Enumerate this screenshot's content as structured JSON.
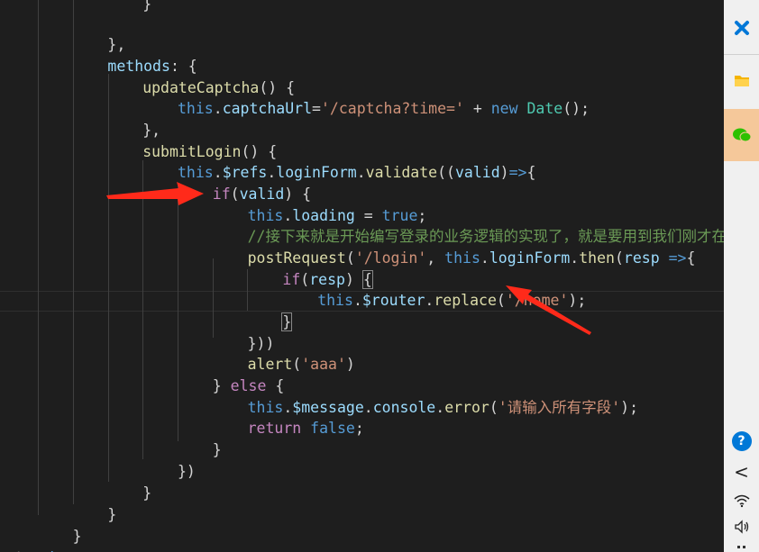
{
  "editor": {
    "lines": [
      [
        {
          "t": "}",
          "c": "pun"
        }
      ],
      [
        {
          "t": "},",
          "c": "pun"
        }
      ],
      [
        {
          "t": "methods",
          "c": "var"
        },
        {
          "t": ": {",
          "c": "pun"
        }
      ],
      [
        {
          "t": "updateCaptcha",
          "c": "fn"
        },
        {
          "t": "() {",
          "c": "pun"
        }
      ],
      [
        {
          "t": "this",
          "c": "kw"
        },
        {
          "t": ".",
          "c": "pun"
        },
        {
          "t": "captchaUrl",
          "c": "var"
        },
        {
          "t": "=",
          "c": "pun"
        },
        {
          "t": "'/captcha?time='",
          "c": "str"
        },
        {
          "t": " + ",
          "c": "pun"
        },
        {
          "t": "new",
          "c": "kw"
        },
        {
          "t": " ",
          "c": "pun"
        },
        {
          "t": "Date",
          "c": "cls"
        },
        {
          "t": "();",
          "c": "pun"
        }
      ],
      [
        {
          "t": "},",
          "c": "pun"
        }
      ],
      [
        {
          "t": "submitLogin",
          "c": "fn"
        },
        {
          "t": "() {",
          "c": "pun"
        }
      ],
      [
        {
          "t": "this",
          "c": "kw"
        },
        {
          "t": ".",
          "c": "pun"
        },
        {
          "t": "$refs",
          "c": "var"
        },
        {
          "t": ".",
          "c": "pun"
        },
        {
          "t": "loginForm",
          "c": "var"
        },
        {
          "t": ".",
          "c": "pun"
        },
        {
          "t": "validate",
          "c": "fn"
        },
        {
          "t": "((",
          "c": "pun"
        },
        {
          "t": "valid",
          "c": "var"
        },
        {
          "t": ")",
          "c": "pun"
        },
        {
          "t": "=>",
          "c": "kw"
        },
        {
          "t": "{",
          "c": "pun"
        }
      ],
      [
        {
          "t": "if",
          "c": "ctl"
        },
        {
          "t": "(",
          "c": "pun"
        },
        {
          "t": "valid",
          "c": "var"
        },
        {
          "t": ") {",
          "c": "pun"
        }
      ],
      [
        {
          "t": "this",
          "c": "kw"
        },
        {
          "t": ".",
          "c": "pun"
        },
        {
          "t": "loading",
          "c": "var"
        },
        {
          "t": " = ",
          "c": "pun"
        },
        {
          "t": "true",
          "c": "kw"
        },
        {
          "t": ";",
          "c": "pun"
        }
      ],
      [
        {
          "t": "//接下来就是开始编写登录的业务逻辑的实现了，就是要用到我们刚才在",
          "c": "com"
        }
      ],
      [
        {
          "t": "postRequest",
          "c": "fn"
        },
        {
          "t": "(",
          "c": "pun"
        },
        {
          "t": "'/login'",
          "c": "str"
        },
        {
          "t": ", ",
          "c": "pun"
        },
        {
          "t": "this",
          "c": "kw"
        },
        {
          "t": ".",
          "c": "pun"
        },
        {
          "t": "loginForm",
          "c": "var"
        },
        {
          "t": ".",
          "c": "pun"
        },
        {
          "t": "then",
          "c": "fn"
        },
        {
          "t": "(",
          "c": "pun"
        },
        {
          "t": "resp",
          "c": "var"
        },
        {
          "t": " ",
          "c": "pun"
        },
        {
          "t": "=>",
          "c": "kw"
        },
        {
          "t": "{",
          "c": "pun"
        }
      ],
      [
        {
          "t": "if",
          "c": "ctl"
        },
        {
          "t": "(",
          "c": "pun"
        },
        {
          "t": "resp",
          "c": "var"
        },
        {
          "t": ") ",
          "c": "pun"
        },
        {
          "t": "{",
          "c": "brk"
        }
      ],
      [
        {
          "t": "this",
          "c": "kw"
        },
        {
          "t": ".",
          "c": "pun"
        },
        {
          "t": "$router",
          "c": "var"
        },
        {
          "t": ".",
          "c": "pun"
        },
        {
          "t": "replace",
          "c": "fn"
        },
        {
          "t": "(",
          "c": "pun"
        },
        {
          "t": "'/home'",
          "c": "str"
        },
        {
          "t": ");",
          "c": "pun"
        }
      ],
      [
        {
          "t": "}",
          "c": "brk"
        }
      ],
      [
        {
          "t": "}))",
          "c": "pun"
        }
      ],
      [
        {
          "t": "alert",
          "c": "fn"
        },
        {
          "t": "(",
          "c": "pun"
        },
        {
          "t": "'aaa'",
          "c": "str"
        },
        {
          "t": ")",
          "c": "pun"
        }
      ],
      [
        {
          "t": "} ",
          "c": "pun"
        },
        {
          "t": "else",
          "c": "ctl"
        },
        {
          "t": " {",
          "c": "pun"
        }
      ],
      [
        {
          "t": "this",
          "c": "kw"
        },
        {
          "t": ".",
          "c": "pun"
        },
        {
          "t": "$message",
          "c": "var"
        },
        {
          "t": ".",
          "c": "pun"
        },
        {
          "t": "console",
          "c": "var"
        },
        {
          "t": ".",
          "c": "pun"
        },
        {
          "t": "error",
          "c": "fn"
        },
        {
          "t": "(",
          "c": "pun"
        },
        {
          "t": "'请输入所有字段'",
          "c": "str"
        },
        {
          "t": ");",
          "c": "pun"
        }
      ],
      [
        {
          "t": "return",
          "c": "ctl"
        },
        {
          "t": " ",
          "c": "pun"
        },
        {
          "t": "false",
          "c": "kw"
        },
        {
          "t": ";",
          "c": "pun"
        }
      ],
      [
        {
          "t": "}",
          "c": "pun"
        }
      ],
      [
        {
          "t": "})",
          "c": "pun"
        }
      ],
      [
        {
          "t": "}",
          "c": "pun"
        }
      ],
      [
        {
          "t": "}",
          "c": "pun"
        }
      ],
      [
        {
          "t": "}",
          "c": "pun"
        }
      ],
      [
        {
          "t": "</",
          "c": "gray"
        },
        {
          "t": "script",
          "c": "kw"
        },
        {
          "t": ">",
          "c": "gray"
        }
      ]
    ]
  },
  "side_panel": {
    "icons": [
      "close-icon",
      "folder-icon",
      "wechat-icon",
      "help-icon",
      "chevron-left-icon",
      "wifi-icon",
      "speaker-icon"
    ],
    "help_label": "?",
    "chevron_label": "<",
    "colors": {
      "close": "#0078d7",
      "folder": "#f5b400",
      "wechat": "#2dc100",
      "highlight": "#f5c89a",
      "help": "#0078d7"
    }
  },
  "annotations": {
    "arrow_color": "#ff2a1a"
  }
}
